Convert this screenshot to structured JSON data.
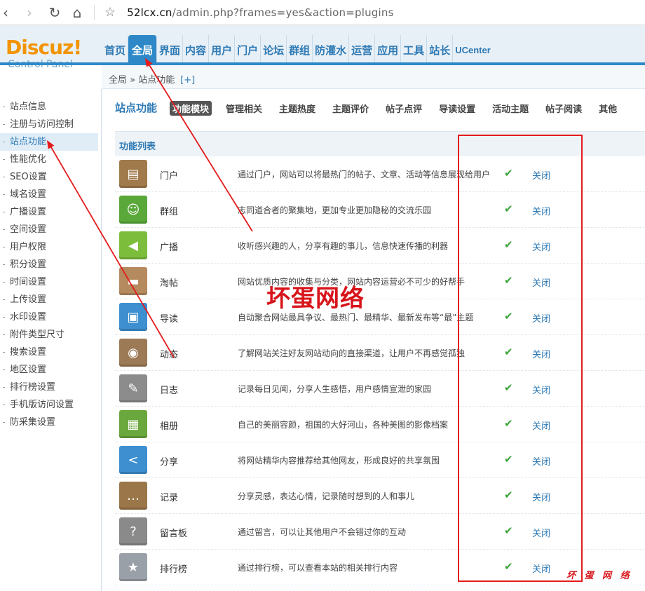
{
  "browser": {
    "url_host": "52lcx.cn",
    "url_rest": "/admin.php?frames=yes&action=plugins"
  },
  "logo": {
    "title": "Discuz!",
    "subtitle": "Control Panel"
  },
  "topnav": [
    "首页",
    "全局",
    "界面",
    "内容",
    "用户",
    "门户",
    "论坛",
    "群组",
    "防灌水",
    "运营",
    "应用",
    "工具",
    "站长",
    "UCenter"
  ],
  "topnav_active": "全局",
  "breadcrumb": {
    "path": "全局 » 站点功能",
    "plus": "[+]"
  },
  "sidebar": [
    "站点信息",
    "注册与访问控制",
    "站点功能",
    "性能优化",
    "SEO设置",
    "域名设置",
    "广播设置",
    "空间设置",
    "用户权限",
    "积分设置",
    "时间设置",
    "上传设置",
    "水印设置",
    "附件类型尺寸",
    "搜索设置",
    "地区设置",
    "排行榜设置",
    "手机版访问设置",
    "防采集设置"
  ],
  "sidebar_active": "站点功能",
  "section_title": "站点功能",
  "subtabs": [
    "功能模块",
    "管理相关",
    "主题热度",
    "主题评价",
    "帖子点评",
    "导读设置",
    "活动主题",
    "帖子阅读",
    "其他"
  ],
  "subtab_active": "功能模块",
  "list_header": "功能列表",
  "modules": [
    {
      "name": "门户",
      "desc": "通过门户，网站可以将最热门的帖子、文章、活动等信息展现给用户",
      "action": "关闭",
      "icon": "portal-icon",
      "color": "#a07a4a",
      "glyph": "▤"
    },
    {
      "name": "群组",
      "desc": "志同道合者的聚集地，更加专业更加隐秘的交流乐园",
      "action": "关闭",
      "icon": "group-icon",
      "color": "#5aa83a",
      "glyph": "☺"
    },
    {
      "name": "广播",
      "desc": "收听感兴趣的人，分享有趣的事儿，信息快速传播的利器",
      "action": "关闭",
      "icon": "megaphone-icon",
      "color": "#7cbd3c",
      "glyph": "◀"
    },
    {
      "name": "淘帖",
      "desc": "网站优质内容的收集与分类，网站内容运营必不可少的好帮手",
      "action": "关闭",
      "icon": "collection-icon",
      "color": "#b58a5e",
      "glyph": "▬"
    },
    {
      "name": "导读",
      "desc": "自动聚合网站最具争议、最热门、最精华、最新发布等“最”主题",
      "action": "关闭",
      "icon": "guide-icon",
      "color": "#3d8fd0",
      "glyph": "▣"
    },
    {
      "name": "动态",
      "desc": "了解网站关注好友网站动向的直接渠道，让用户不再感觉孤独",
      "action": "关闭",
      "icon": "rss-feed-icon",
      "color": "#9c7a55",
      "glyph": "◉"
    },
    {
      "name": "日志",
      "desc": "记录每日见闻，分享人生感悟，用户感情宣泄的家园",
      "action": "关闭",
      "icon": "blog-icon",
      "color": "#8c8c8c",
      "glyph": "✎"
    },
    {
      "name": "相册",
      "desc": "自己的美丽容颜，祖国的大好河山，各种美图的影像档案",
      "action": "关闭",
      "icon": "album-icon",
      "color": "#6aa83e",
      "glyph": "▦"
    },
    {
      "name": "分享",
      "desc": "将网站精华内容推荐给其他网友，形成良好的共享氛围",
      "action": "关闭",
      "icon": "share-icon",
      "color": "#3d8fd0",
      "glyph": "<"
    },
    {
      "name": "记录",
      "desc": "分享灵感，表达心情，记录随时想到的人和事儿",
      "action": "关闭",
      "icon": "speech-bubble-icon",
      "color": "#9a7648",
      "glyph": "…"
    },
    {
      "name": "留言板",
      "desc": "通过留言，可以让其他用户不会错过你的互动",
      "action": "关闭",
      "icon": "guestbook-icon",
      "color": "#8a8a8a",
      "glyph": "?"
    },
    {
      "name": "排行榜",
      "desc": "通过排行榜，可以查看本站的相关排行内容",
      "action": "关闭",
      "icon": "ranking-icon",
      "color": "#9aa0a8",
      "glyph": "★"
    }
  ],
  "status_check": "✔",
  "watermark_big": "坏蛋网络",
  "watermark_small": "坏 蛋 网 络"
}
